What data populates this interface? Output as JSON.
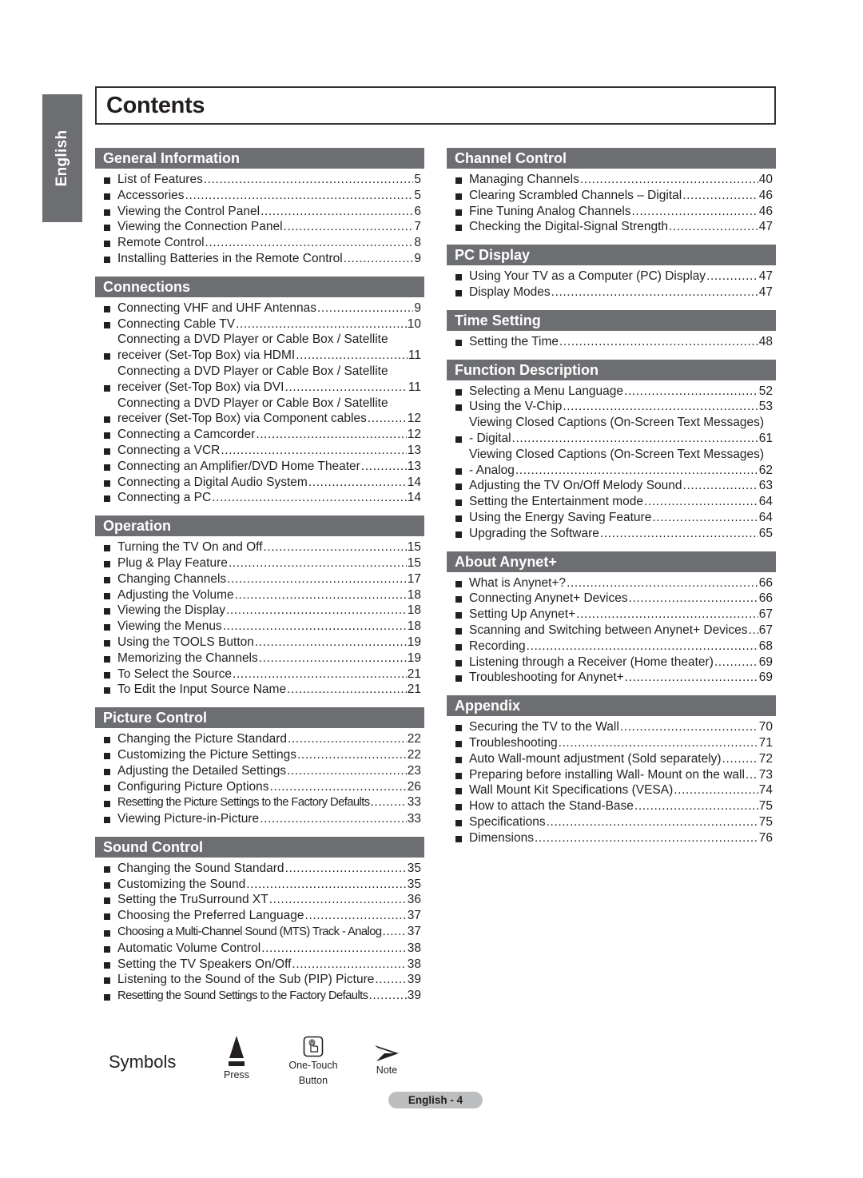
{
  "side_tab": {
    "label": "English"
  },
  "title": "Contents",
  "colors": {
    "section_header_bg": "#6d6e71",
    "section_header_text": "#ffffff",
    "badge_bg": "#bcbec0"
  },
  "left_sections": [
    {
      "title": "General Information",
      "items": [
        {
          "text": "List of Features",
          "page": "5"
        },
        {
          "text": "Accessories",
          "page": "5"
        },
        {
          "text": "Viewing the Control Panel",
          "page": "6"
        },
        {
          "text": "Viewing the Connection Panel",
          "page": "7"
        },
        {
          "text": "Remote Control",
          "page": "8"
        },
        {
          "text": "Installing Batteries in the Remote Control",
          "page": "9"
        }
      ]
    },
    {
      "title": "Connections",
      "items": [
        {
          "text": "Connecting VHF and UHF Antennas",
          "page": "9"
        },
        {
          "text": "Connecting Cable TV",
          "page": "10"
        },
        {
          "line1": "Connecting a DVD Player or Cable Box / Satellite",
          "text": "receiver (Set-Top Box) via HDMI",
          "page": "11"
        },
        {
          "line1": "Connecting a DVD Player or Cable Box / Satellite",
          "text": "receiver (Set-Top Box) via DVI",
          "page": "11"
        },
        {
          "line1": "Connecting a DVD Player or Cable Box / Satellite",
          "text": "receiver (Set-Top Box) via Component cables",
          "page": "12"
        },
        {
          "text": "Connecting a Camcorder",
          "page": "12"
        },
        {
          "text": "Connecting a VCR",
          "page": "13"
        },
        {
          "text": "Connecting an Amplifier/DVD Home Theater",
          "page": "13"
        },
        {
          "text": "Connecting a Digital Audio System",
          "page": "14"
        },
        {
          "text": "Connecting a PC",
          "page": "14"
        }
      ]
    },
    {
      "title": "Operation",
      "items": [
        {
          "text": "Turning the TV On and Off",
          "page": "15"
        },
        {
          "text": "Plug & Play Feature",
          "page": "15"
        },
        {
          "text": "Changing Channels",
          "page": "17"
        },
        {
          "text": "Adjusting the Volume",
          "page": "18"
        },
        {
          "text": "Viewing the Display",
          "page": "18"
        },
        {
          "text": "Viewing the Menus",
          "page": "18"
        },
        {
          "text": "Using the TOOLS Button",
          "page": "19"
        },
        {
          "text": "Memorizing the Channels",
          "page": "19"
        },
        {
          "text": "To Select the Source",
          "page": "21"
        },
        {
          "text": "To Edit the Input Source Name",
          "page": "21"
        }
      ]
    },
    {
      "title": "Picture Control",
      "items": [
        {
          "text": "Changing the Picture Standard",
          "page": "22"
        },
        {
          "text": "Customizing the Picture Settings",
          "page": "22"
        },
        {
          "text": "Adjusting the Detailed Settings",
          "page": "23"
        },
        {
          "text": "Configuring Picture Options",
          "page": "26"
        },
        {
          "text": "Resetting the Picture Settings to the Factory Defaults",
          "page": "33",
          "condensed": true
        },
        {
          "text": "Viewing Picture-in-Picture",
          "page": "33"
        }
      ]
    },
    {
      "title": "Sound Control",
      "items": [
        {
          "text": "Changing the Sound Standard",
          "page": "35"
        },
        {
          "text": "Customizing the Sound",
          "page": "35"
        },
        {
          "text": "Setting the TruSurround XT",
          "page": "36"
        },
        {
          "text": "Choosing the Preferred Language",
          "page": "37"
        },
        {
          "text": "Choosing a Multi-Channel Sound (MTS) Track - Analog",
          "page": "37",
          "condensed": true
        },
        {
          "text": "Automatic Volume Control",
          "page": "38"
        },
        {
          "text": "Setting the TV Speakers On/Off",
          "page": "38"
        },
        {
          "text": "Listening to the Sound of the Sub (PIP) Picture",
          "page": "39"
        },
        {
          "text": "Resetting the Sound Settings to the Factory Defaults",
          "page": "39",
          "condensed": true
        }
      ]
    }
  ],
  "right_sections": [
    {
      "title": "Channel Control",
      "items": [
        {
          "text": "Managing Channels",
          "page": "40"
        },
        {
          "text": "Clearing Scrambled Channels – Digital",
          "page": "46"
        },
        {
          "text": "Fine Tuning Analog Channels",
          "page": "46"
        },
        {
          "text": "Checking the Digital-Signal Strength",
          "page": "47"
        }
      ]
    },
    {
      "title": "PC Display",
      "items": [
        {
          "text": "Using Your TV as a Computer (PC) Display",
          "page": "47"
        },
        {
          "text": "Display Modes",
          "page": "47"
        }
      ]
    },
    {
      "title": "Time Setting",
      "items": [
        {
          "text": "Setting the Time",
          "page": "48"
        }
      ]
    },
    {
      "title": "Function Description",
      "items": [
        {
          "text": "Selecting a Menu Language",
          "page": "52"
        },
        {
          "text": "Using the V-Chip",
          "page": "53"
        },
        {
          "line1": "Viewing Closed Captions (On-Screen Text Messages)",
          "text": "- Digital",
          "page": "61"
        },
        {
          "line1": "Viewing Closed Captions (On-Screen Text Messages)",
          "text": "- Analog",
          "page": "62"
        },
        {
          "text": "Adjusting the TV On/Off Melody Sound",
          "page": "63"
        },
        {
          "text": "Setting the Entertainment mode",
          "page": "64"
        },
        {
          "text": "Using the Energy Saving Feature",
          "page": "64"
        },
        {
          "text": "Upgrading the Software",
          "page": "65"
        }
      ]
    },
    {
      "title": "About Anynet+",
      "items": [
        {
          "text": "What is Anynet+?",
          "page": "66"
        },
        {
          "text": "Connecting Anynet+ Devices",
          "page": "66"
        },
        {
          "text": "Setting Up Anynet+",
          "page": "67"
        },
        {
          "text": "Scanning and Switching between Anynet+ Devices",
          "page": "67"
        },
        {
          "text": "Recording",
          "page": "68"
        },
        {
          "text": "Listening through a Receiver (Home theater)",
          "page": "69"
        },
        {
          "text": "Troubleshooting for Anynet+",
          "page": "69"
        }
      ]
    },
    {
      "title": "Appendix",
      "items": [
        {
          "text": "Securing the TV to the Wall",
          "page": "70"
        },
        {
          "text": "Troubleshooting",
          "page": "71"
        },
        {
          "text": "Auto Wall-mount adjustment (Sold separately)",
          "page": "72"
        },
        {
          "text": "Preparing before installing Wall- Mount on the wall",
          "page": "73"
        },
        {
          "text": "Wall Mount Kit Specifications (VESA)",
          "page": "74"
        },
        {
          "text": "How to attach the Stand-Base",
          "page": "75"
        },
        {
          "text": "Specifications",
          "page": "75"
        },
        {
          "text": "Dimensions",
          "page": "76"
        }
      ]
    }
  ],
  "symbols": {
    "label": "Symbols",
    "items": [
      {
        "icon": "press-icon",
        "label": "Press"
      },
      {
        "icon": "one-touch-button-icon",
        "label_line1": "One-Touch",
        "label_line2": "Button"
      },
      {
        "icon": "note-icon",
        "label": "Note"
      }
    ]
  },
  "footer": {
    "page_label": "English - 4"
  }
}
